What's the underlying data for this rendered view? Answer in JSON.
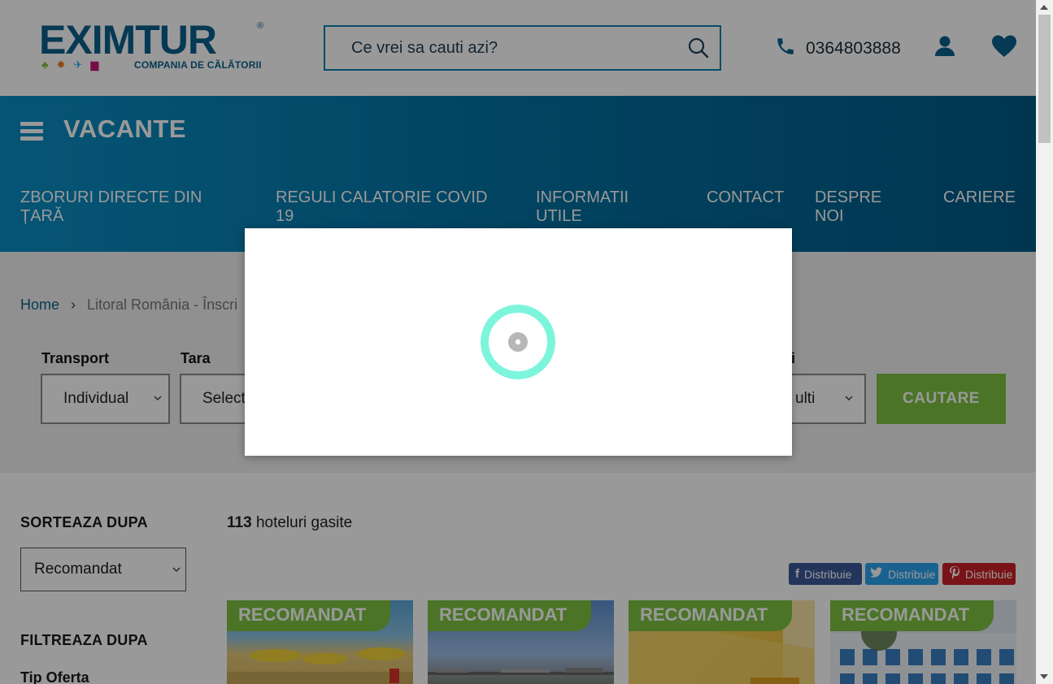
{
  "header": {
    "logo_text": "EXIMTUR",
    "logo_reg": "®",
    "logo_tagline": "COMPANIA DE CĂLĂTORII",
    "search_placeholder": "Ce vrei sa cauti azi?",
    "phone_number": "0364803888"
  },
  "nav": {
    "title": "VACANTE",
    "links": [
      {
        "label": "ZBORURI DIRECTE DIN ȚARĂ"
      },
      {
        "label": "REGULI CALATORIE COVID 19"
      },
      {
        "label": "INFORMATII UTILE"
      },
      {
        "label": "CONTACT"
      },
      {
        "label": "DESPRE NOI"
      },
      {
        "label": "CARIERE"
      }
    ]
  },
  "breadcrumb": {
    "home": "Home",
    "separator": "›",
    "current": "Litoral România - Înscri"
  },
  "search_form": {
    "transport_label": "Transport",
    "transport_value": "Individual",
    "country_label": "Tara",
    "country_value": "Select",
    "rooms_label": "ri",
    "rooms_value": "ulti",
    "submit_label": "CAUTARE"
  },
  "results": {
    "sort_title": "SORTEAZA DUPA",
    "sort_value": "Recomandat",
    "filter_title": "FILTREAZA DUPA",
    "filter_sub": "Tip Oferta",
    "count": "113",
    "count_suffix": "hoteluri gasite",
    "share": {
      "facebook": "Distribuie",
      "twitter": "Distribuie",
      "pinterest": "Distribuie"
    },
    "cards": [
      {
        "tag": "RECOMANDAT"
      },
      {
        "tag": "RECOMANDAT"
      },
      {
        "tag": "RECOMANDAT"
      },
      {
        "tag": "RECOMANDAT"
      }
    ]
  },
  "colors": {
    "brand_blue": "#0a5f8a",
    "nav_gradient_start": "#0b8ec4",
    "nav_gradient_end": "#005a86",
    "accent_green": "#7ec242",
    "spinner_ring": "#7cf5dc",
    "facebook": "#3b5998",
    "twitter": "#2aa3ef",
    "pinterest": "#cb2027"
  },
  "icons": {
    "search": "search-icon",
    "phone": "phone-icon",
    "user": "user-icon",
    "favorites": "heart-icon",
    "menu": "hamburger-icon",
    "loading": "spinner-icon"
  }
}
